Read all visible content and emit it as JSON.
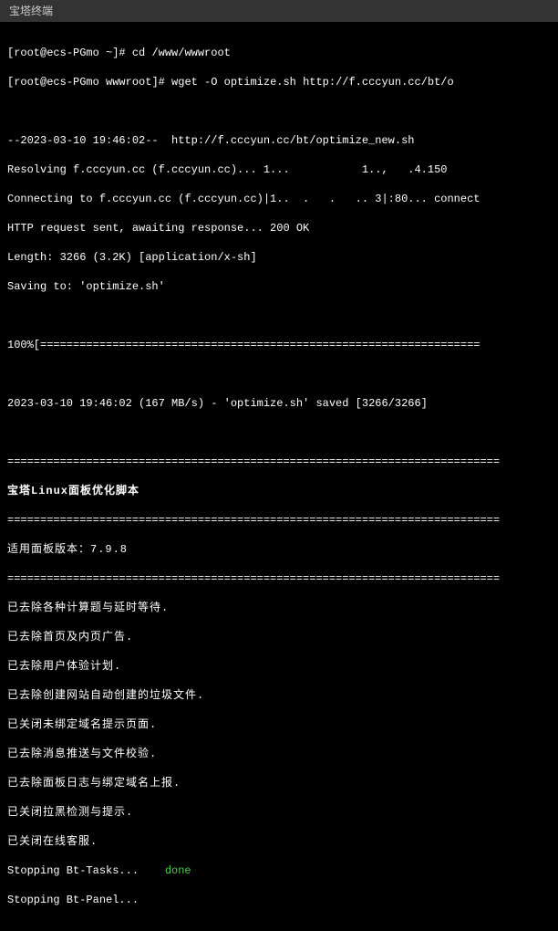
{
  "window": {
    "title": "宝塔终端"
  },
  "prompt1": {
    "open": "[",
    "user_host": "root@ecs-PGmo ~",
    "close": "]# ",
    "cmd": "cd /www/wwwroot"
  },
  "prompt2": {
    "open": "[",
    "user_host": "root@ecs-PGmo wwwroot",
    "close": "]# ",
    "cmd": "wget -O optimize.sh http://f.cccyun.cc/bt/o"
  },
  "wget": {
    "line1": "--2023-03-10 19:46:02--  http://f.cccyun.cc/bt/optimize_new.sh",
    "line2": "Resolving f.cccyun.cc (f.cccyun.cc)... 1...           1..,   .4.150",
    "line3": "Connecting to f.cccyun.cc (f.cccyun.cc)|1..  .   .   .. 3|:80... connect",
    "line4": "HTTP request sent, awaiting response... 200 OK",
    "line5": "Length: 3266 (3.2K) [application/x-sh]",
    "line6": "Saving to: 'optimize.sh'",
    "progress": "100%[===================================================================",
    "line7": "2023-03-10 19:46:02 (167 MB/s) - 'optimize.sh' saved [3266/3266]"
  },
  "script": {
    "divider": "===========================================================================",
    "title": "宝塔Linux面板优化脚本",
    "version": "适用面板版本：7.9.8",
    "lines": [
      "已去除各种计算题与延时等待.",
      "已去除首页及内页广告.",
      "已去除用户体验计划.",
      "已去除创建网站自动创建的垃圾文件.",
      "已关闭未绑定域名提示页面.",
      "已去除消息推送与文件校验.",
      "已去除面板日志与绑定域名上报.",
      "已关闭拉黑检测与提示.",
      "已关闭在线客服."
    ],
    "stop1_label": "Stopping Bt-Tasks...    ",
    "stop1_status": "done",
    "stop2": "Stopping Bt-Panel..."
  }
}
